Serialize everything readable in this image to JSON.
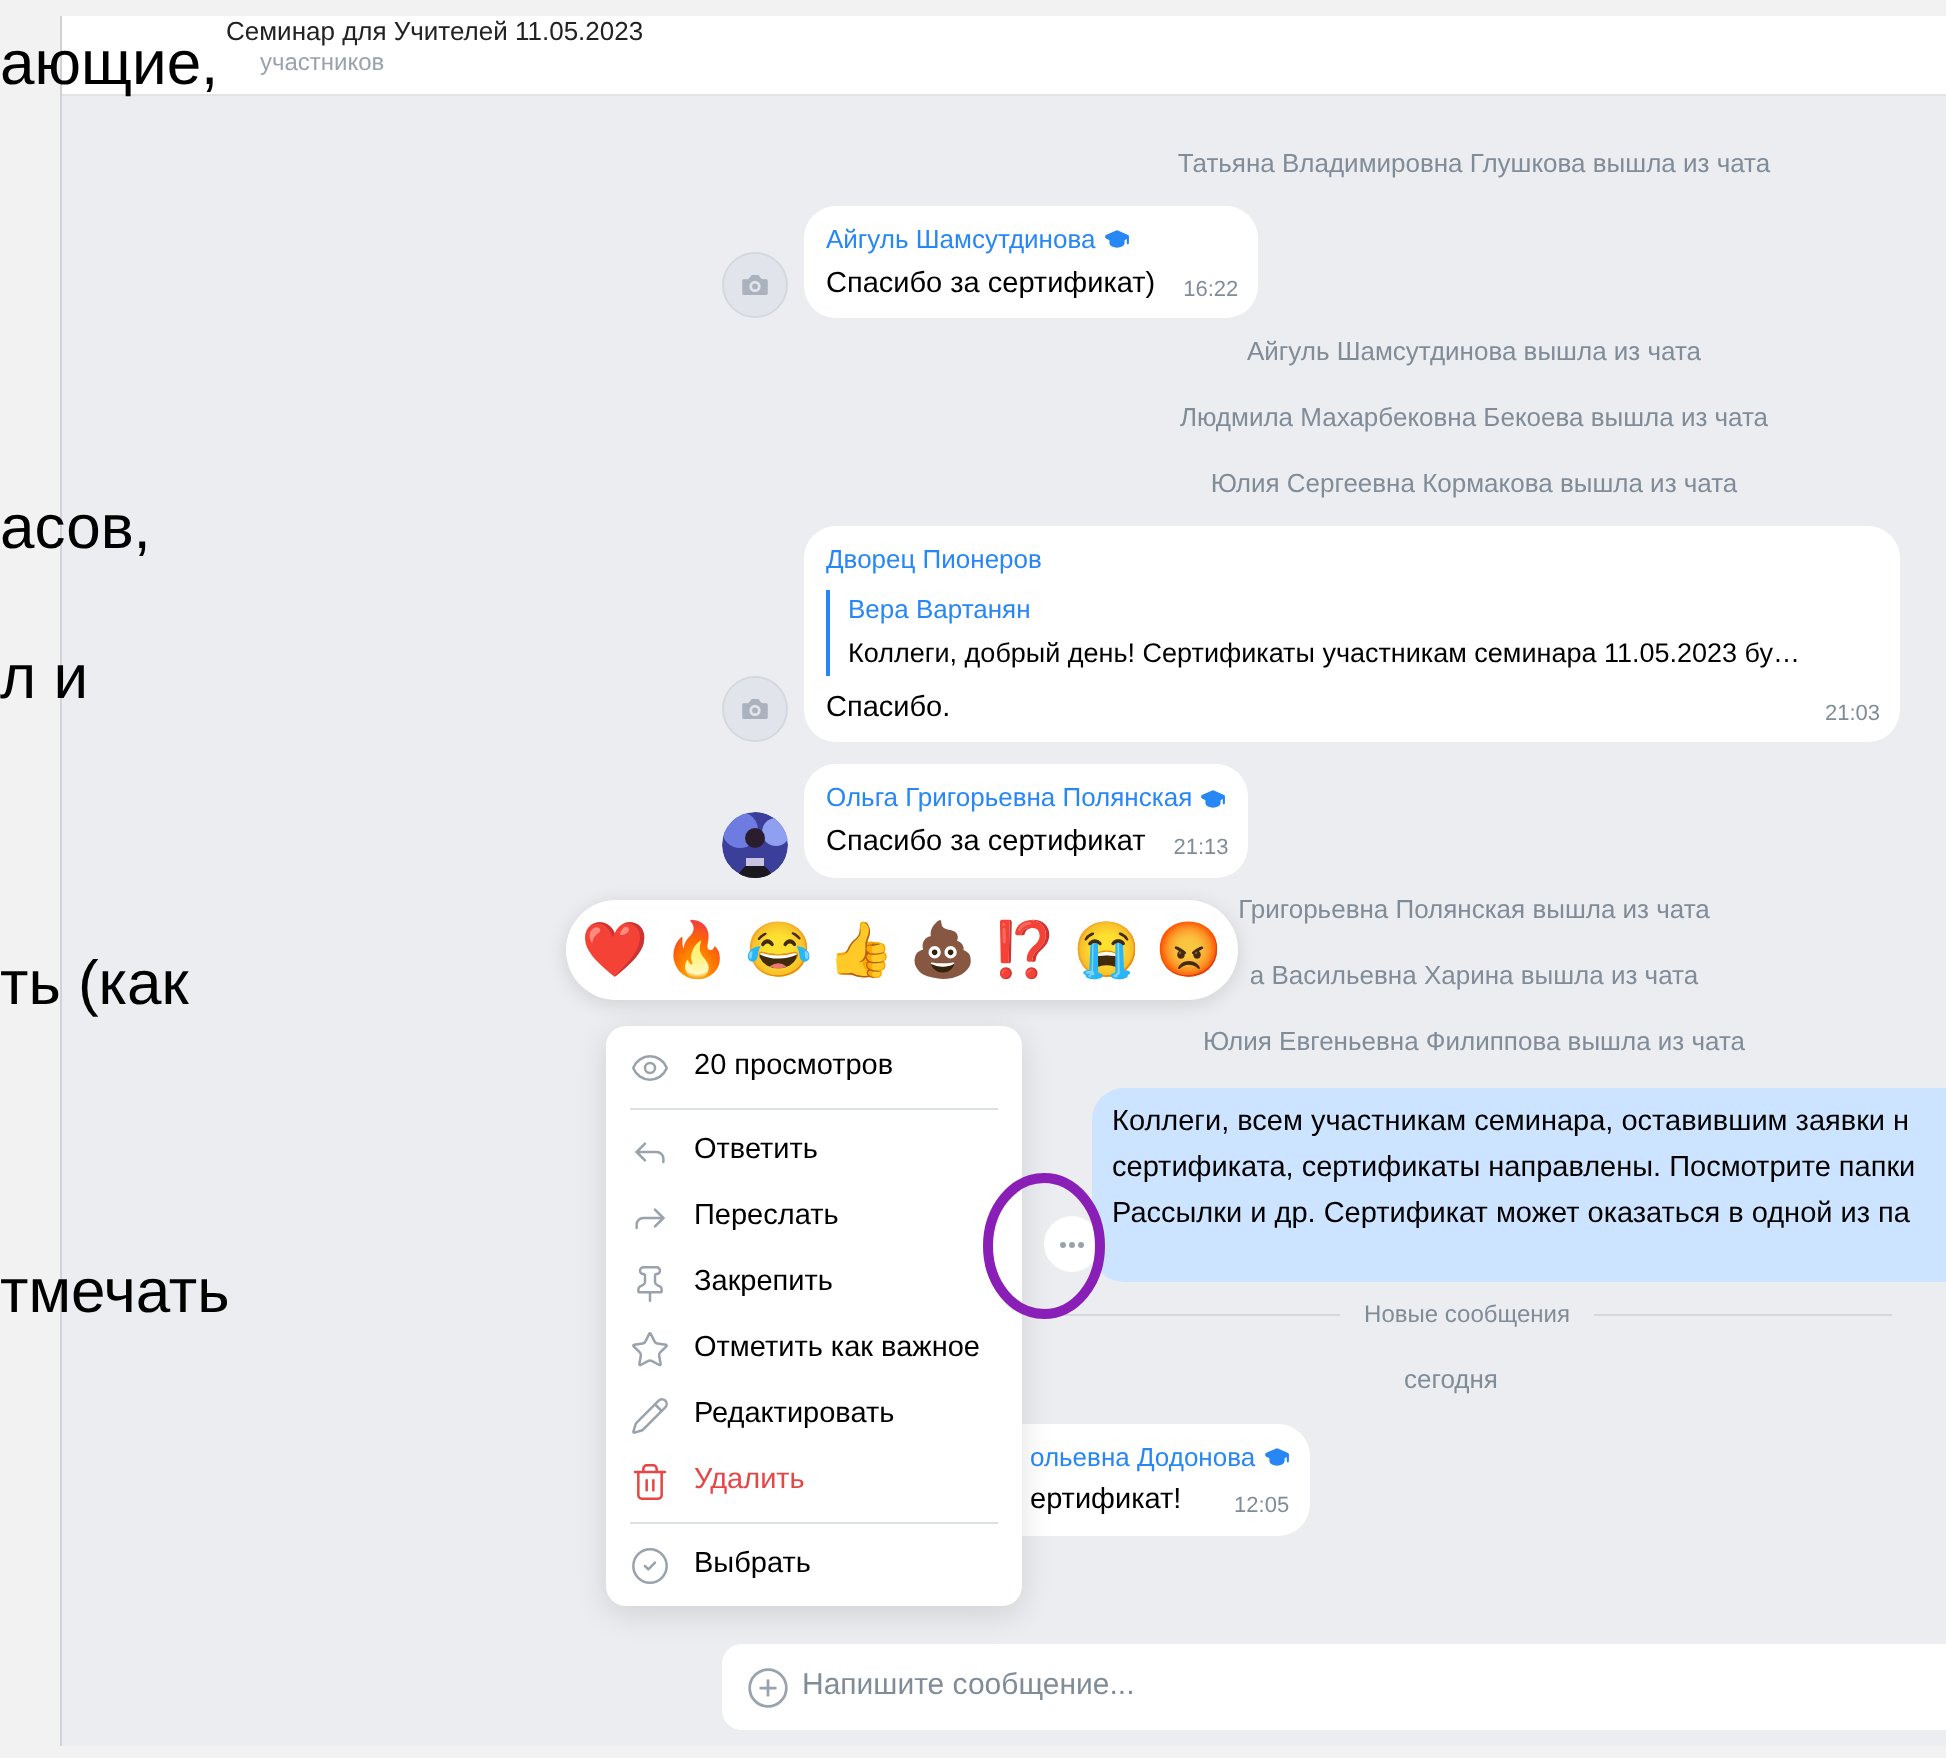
{
  "slide_text_fragments": [
    "ающие,",
    "асов,",
    "л и",
    "ть (как",
    "тмечать"
  ],
  "header": {
    "title": "Семинар для Учителей 11.05.2023",
    "subtitle": "участников"
  },
  "messages": [
    {
      "kind": "system",
      "text": "Татьяна Владимировна Глушкова вышла из чата"
    },
    {
      "kind": "incoming",
      "avatar": {
        "kind": "camera"
      },
      "author": "Айгуль Шамсутдинова",
      "verified": true,
      "text": "Спасибо за сертификат)",
      "time": "16:22"
    },
    {
      "kind": "system",
      "text": "Айгуль Шамсутдинова вышла из чата"
    },
    {
      "kind": "system",
      "text": "Людмила Махарбековна Бекоева вышла из чата"
    },
    {
      "kind": "system",
      "text": "Юлия Сергеевна Кормакова вышла из чата"
    },
    {
      "kind": "incoming",
      "avatar": {
        "kind": "camera"
      },
      "author": "Дворец Пионеров",
      "verified": false,
      "reply": {
        "author": "Вера Вартанян",
        "text": "Коллеги, добрый день! Сертификаты участникам семинара 11.05.2023 бу…"
      },
      "text": "Спасибо.",
      "time": "21:03"
    },
    {
      "kind": "incoming",
      "author": "Ольга Григорьевна Полянская",
      "verified": true,
      "text": "Спасибо за сертификат",
      "time": "21:13"
    },
    {
      "kind": "system",
      "text": "Григорьевна Полянская вышла из чата"
    },
    {
      "kind": "system",
      "text": "а Васильевна Харина вышла из чата"
    },
    {
      "kind": "system",
      "text": "Юлия Евгеньевна Филиппова вышла из чата"
    },
    {
      "kind": "outgoing",
      "lines": [
        "Коллеги, всем участникам семинара, оставившим заявки н",
        "сертификата, сертификаты направлены. Посмотрите папки",
        "Рассылки и др. Сертификат может оказаться в одной из па"
      ]
    },
    {
      "kind": "divider",
      "text": "Новые сообщения"
    },
    {
      "kind": "date",
      "text": "сегодня"
    },
    {
      "kind": "incoming_partial",
      "author": "ольевна Додонова",
      "verified": true,
      "text": "ертификат!",
      "time": "12:05"
    }
  ],
  "reactions": [
    "❤️",
    "🔥",
    "😂",
    "👍",
    "💩",
    "⁉️",
    "😭",
    "😡"
  ],
  "context_menu": {
    "views": "20 просмотров",
    "items": [
      {
        "kind": "reply",
        "label": "Ответить"
      },
      {
        "kind": "forward",
        "label": "Переслать"
      },
      {
        "kind": "pin",
        "label": "Закрепить"
      },
      {
        "kind": "star",
        "label": "Отметить как важное"
      },
      {
        "kind": "edit",
        "label": "Редактировать"
      },
      {
        "kind": "delete",
        "label": "Удалить"
      },
      {
        "kind": "select",
        "label": "Выбрать"
      }
    ]
  },
  "composer": {
    "placeholder": "Напишите сообщение..."
  }
}
